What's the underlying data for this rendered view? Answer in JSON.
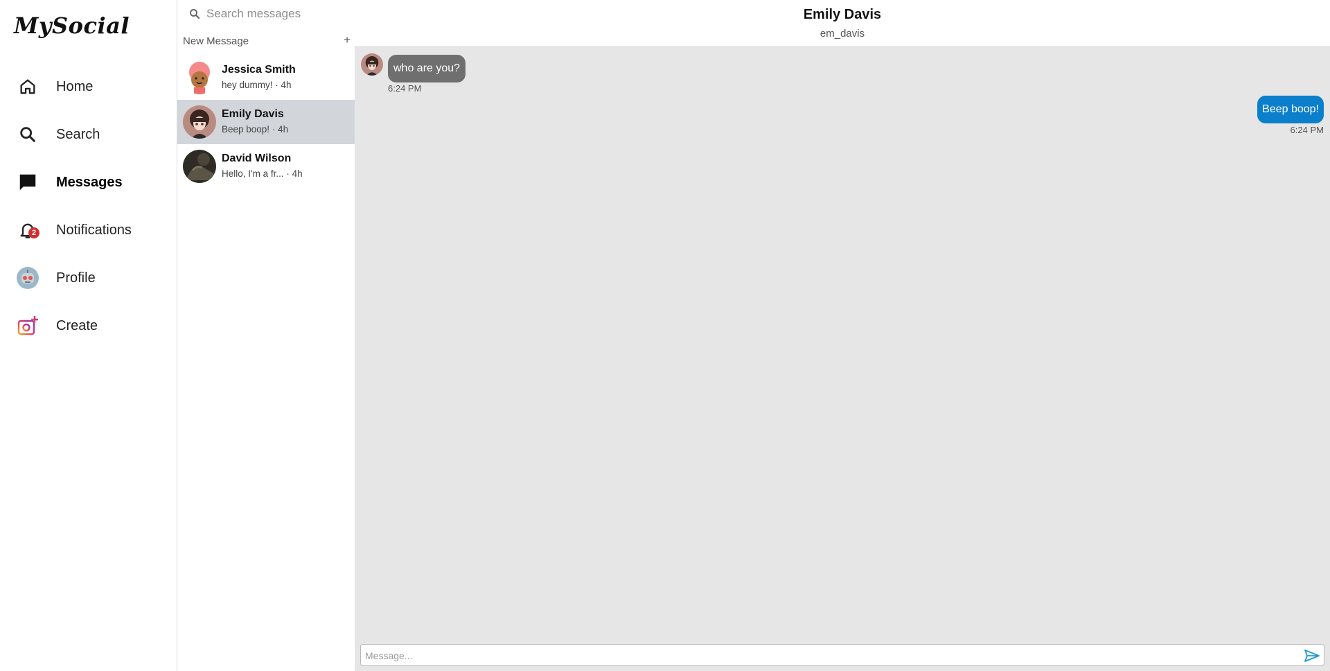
{
  "app": {
    "logo": "MySocial"
  },
  "nav": {
    "items": [
      {
        "label": "Home",
        "icon": "home-icon"
      },
      {
        "label": "Search",
        "icon": "search-icon"
      },
      {
        "label": "Messages",
        "icon": "chat-bubble-icon",
        "active": true
      },
      {
        "label": "Notifications",
        "icon": "bell-icon",
        "badge": "2"
      },
      {
        "label": "Profile",
        "icon": "robot-avatar-icon"
      },
      {
        "label": "Create",
        "icon": "add-photo-icon"
      }
    ]
  },
  "conversations": {
    "search_placeholder": "Search messages",
    "new_message_label": "New Message",
    "new_message_icon": "+",
    "items": [
      {
        "name": "Jessica Smith",
        "preview": "hey dummy! · 4h"
      },
      {
        "name": "Emily Davis",
        "preview": "Beep boop! · 4h",
        "selected": true
      },
      {
        "name": "David Wilson",
        "preview": "Hello, I'm a fr... · 4h"
      }
    ]
  },
  "chat": {
    "name": "Emily Davis",
    "username": "em_davis",
    "messages": [
      {
        "direction": "incoming",
        "text": "who are you?",
        "time": "6:24 PM"
      },
      {
        "direction": "outgoing",
        "text": "Beep boop!",
        "time": "6:24 PM"
      }
    ],
    "composer_placeholder": "Message..."
  },
  "colors": {
    "outgoing_bubble": "#0b7fcc",
    "incoming_bubble": "#6f6f6f",
    "chat_background": "#e6e6e6",
    "selected_conversation": "#d2d5da",
    "badge": "#d32f2f"
  }
}
